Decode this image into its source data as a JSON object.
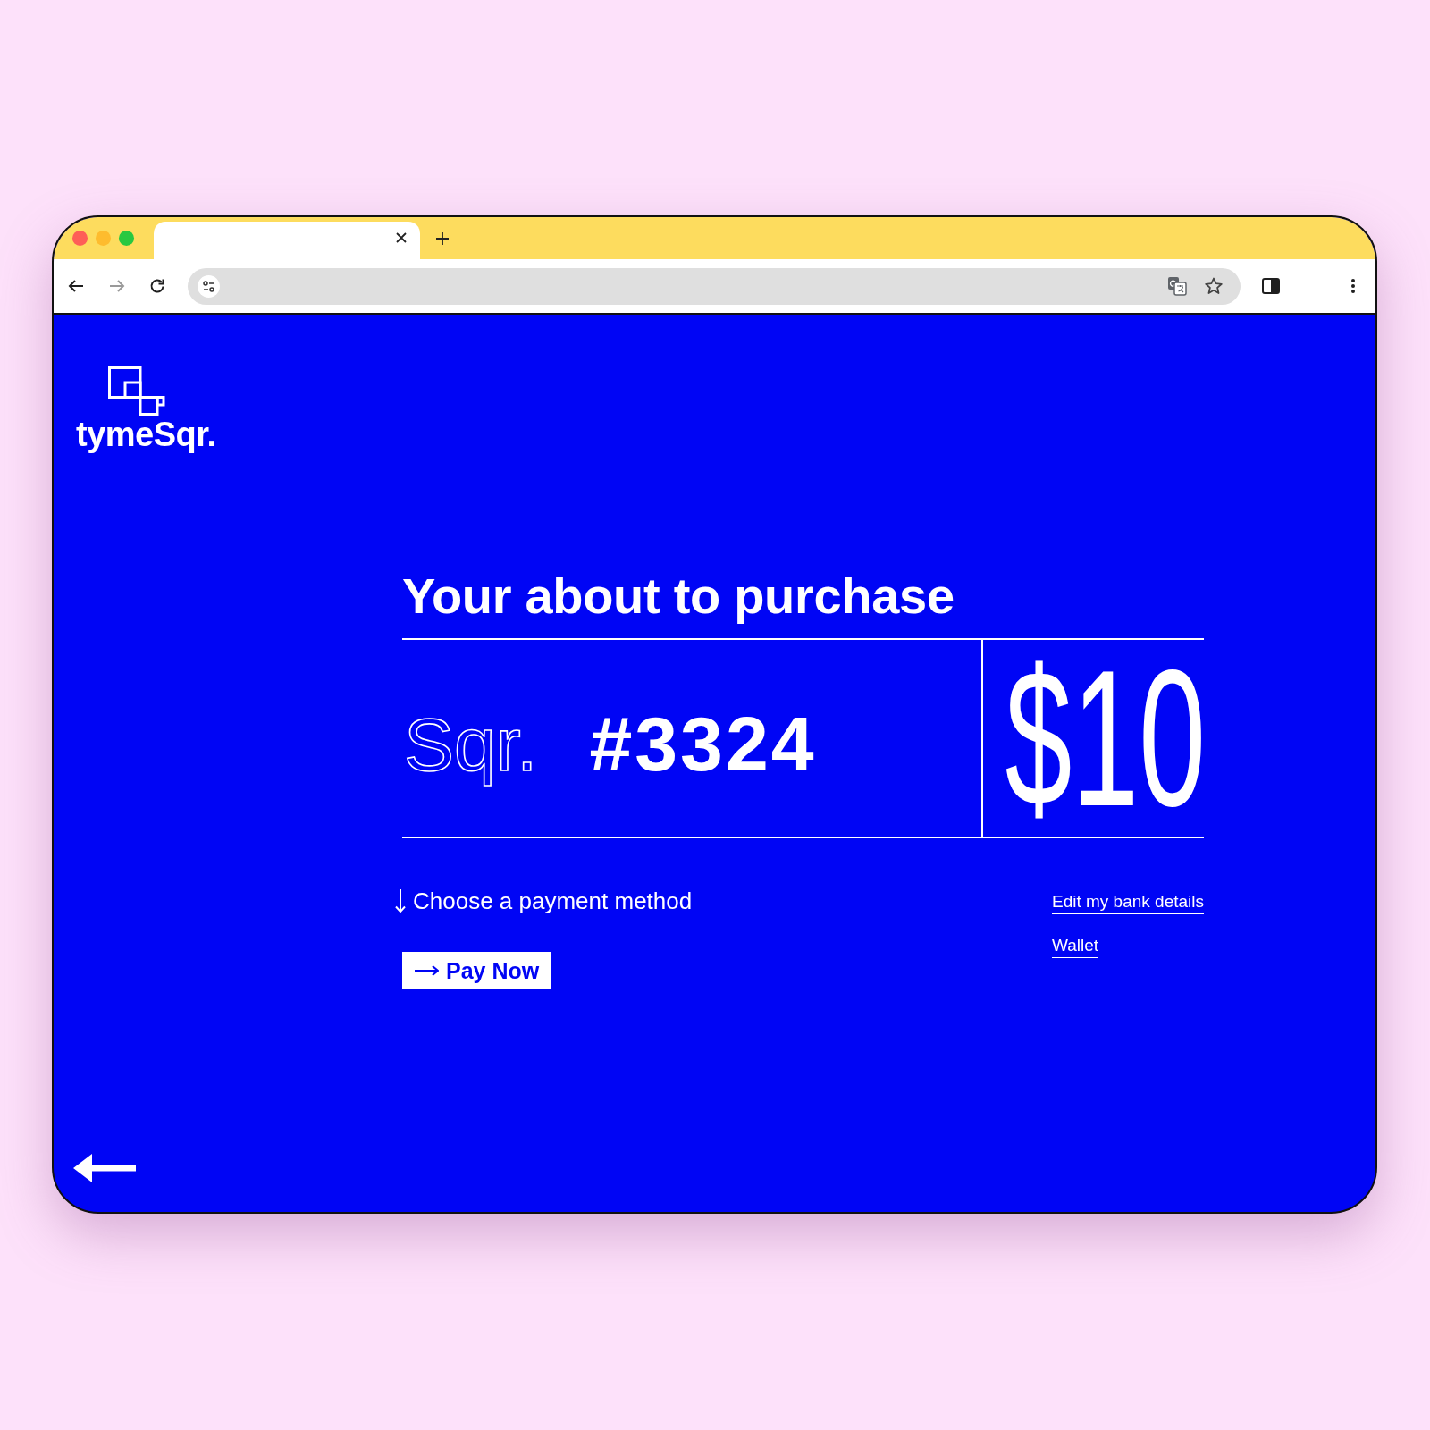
{
  "browser": {
    "tabs": [
      {
        "selected": true
      }
    ]
  },
  "brand": {
    "name": "tymeSqr."
  },
  "purchase": {
    "heading": "Your about to purchase",
    "item_prefix": "Sqr.",
    "item_number": "#3324",
    "price": "$10"
  },
  "payment": {
    "prompt": "Choose a payment method",
    "button": "Pay Now"
  },
  "links": [
    "Edit my bank details",
    "Wallet"
  ]
}
